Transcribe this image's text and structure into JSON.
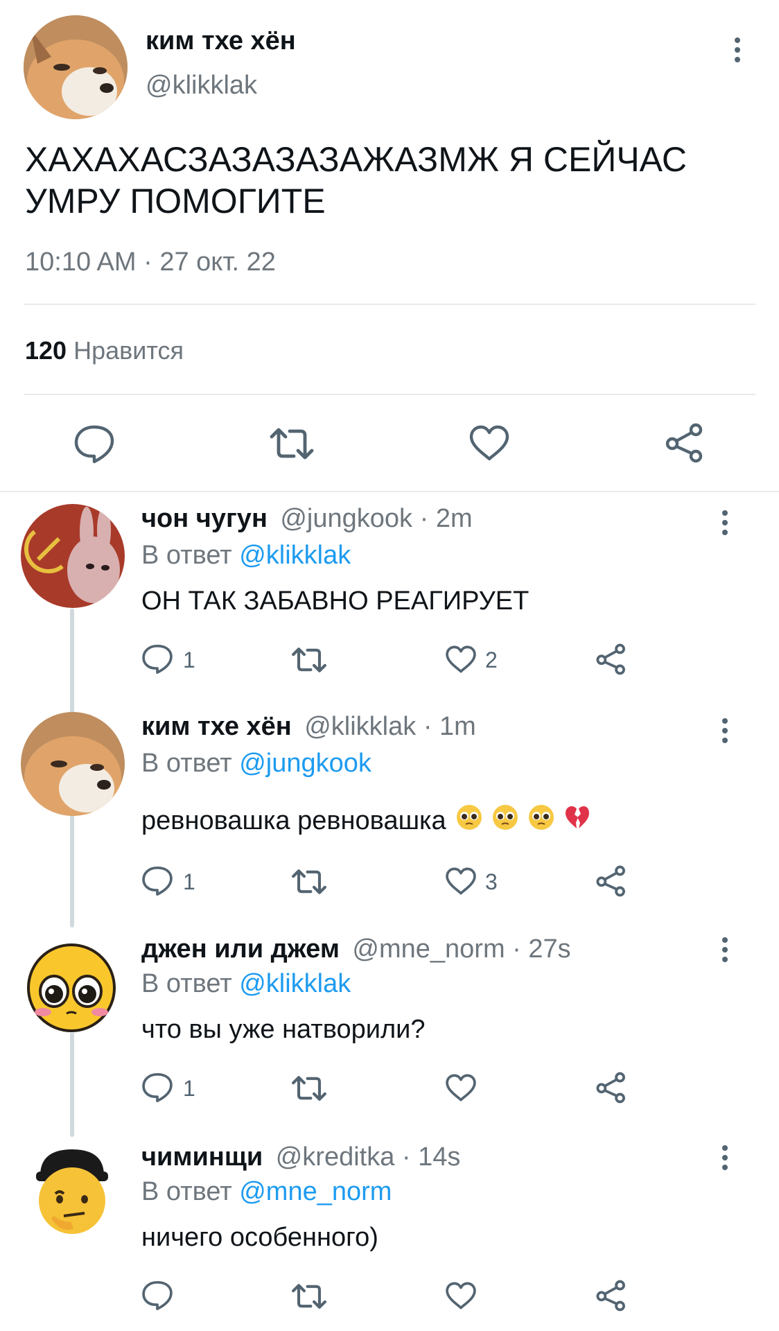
{
  "main_tweet": {
    "author_name": "ким тхе хён",
    "author_handle": "@klikklak",
    "text_line1": "ХАХАХАСЗАЗАЗАЗАЖАЗМЖ Я СЕЙЧАС",
    "text_line2": "УМРУ ПОМОГИТЕ",
    "timestamp": "10:10 AM · 27 окт. 22",
    "likes_count": "120",
    "likes_label": "Нравится"
  },
  "replies": [
    {
      "name": "чон чугун",
      "handle_time": "@jungkook · 2m",
      "reply_prefix": "В ответ",
      "reply_to": "@klikklak",
      "text": "ОН ТАК ЗАБАВНО РЕАГИРУЕТ",
      "reply_count": "1",
      "like_count": "2"
    },
    {
      "name": "ким тхе хён",
      "handle_time": "@klikklak · 1m",
      "reply_prefix": "В ответ",
      "reply_to": "@jungkook",
      "text": "ревновашка ревновашка",
      "reply_count": "1",
      "like_count": "3"
    },
    {
      "name": "джен или джем",
      "handle_time": "@mne_norm · 27s",
      "reply_prefix": "В ответ",
      "reply_to": "@klikklak",
      "text": "что вы уже натворили?",
      "reply_count": "1",
      "like_count": ""
    },
    {
      "name": "чиминщи",
      "handle_time": "@kreditka · 14s",
      "reply_prefix": "В ответ",
      "reply_to": "@mne_norm",
      "text": "ничего особенного)",
      "reply_count": "",
      "like_count": ""
    }
  ],
  "icons": [
    "reply-icon",
    "retweet-icon",
    "like-icon",
    "share-icon",
    "more-icon",
    "pleading-face-emoji",
    "broken-heart-emoji"
  ],
  "colors": {
    "link": "#1d9bf0",
    "muted": "#6e767d",
    "divider": "#e7e9ea",
    "icon": "#536471"
  }
}
